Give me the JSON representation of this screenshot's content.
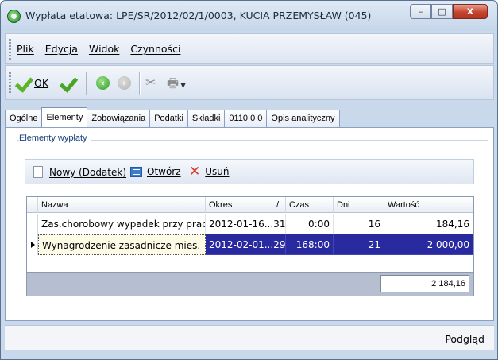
{
  "window": {
    "title": "Wypłata etatowa: LPE/SR/2012/02/1/0003, KUCIA PRZEMYSŁAW (045)",
    "minimize": "–",
    "maximize": "□",
    "close": "x"
  },
  "menu": {
    "items": [
      "Plik",
      "Edycja",
      "Widok",
      "Czynności"
    ]
  },
  "toolbar": {
    "ok_label": "OK"
  },
  "tabs": [
    "Ogólne",
    "Elementy",
    "Zobowiązania",
    "Podatki",
    "Składki",
    "0110 0 0",
    "Opis analityczny"
  ],
  "active_tab": "Elementy",
  "panel": {
    "group_label": "Elementy wypłaty",
    "new_label": "Nowy (Dodatek)",
    "open_label": "Otwórz",
    "delete_label": "Usuń"
  },
  "grid": {
    "columns": [
      "Nazwa",
      "Okres",
      "/",
      "Czas",
      "Dni",
      "Wartość"
    ],
    "rows": [
      {
        "nazwa": "Zas.chorobowy wypadek przy pracy",
        "okres": "2012-01-16...31",
        "czas": "0:00",
        "dni": "16",
        "wartosc": "184,16"
      },
      {
        "nazwa": "Wynagrodzenie zasadnicze mies.",
        "okres": "2012-02-01...29",
        "czas": "168:00",
        "dni": "21",
        "wartosc": "2 000,00"
      }
    ],
    "total": "2 184,16"
  },
  "status": {
    "text": "Podgląd"
  },
  "colors": {
    "selection": "#2a2aa0",
    "window_frame": "#c9d8ea"
  }
}
